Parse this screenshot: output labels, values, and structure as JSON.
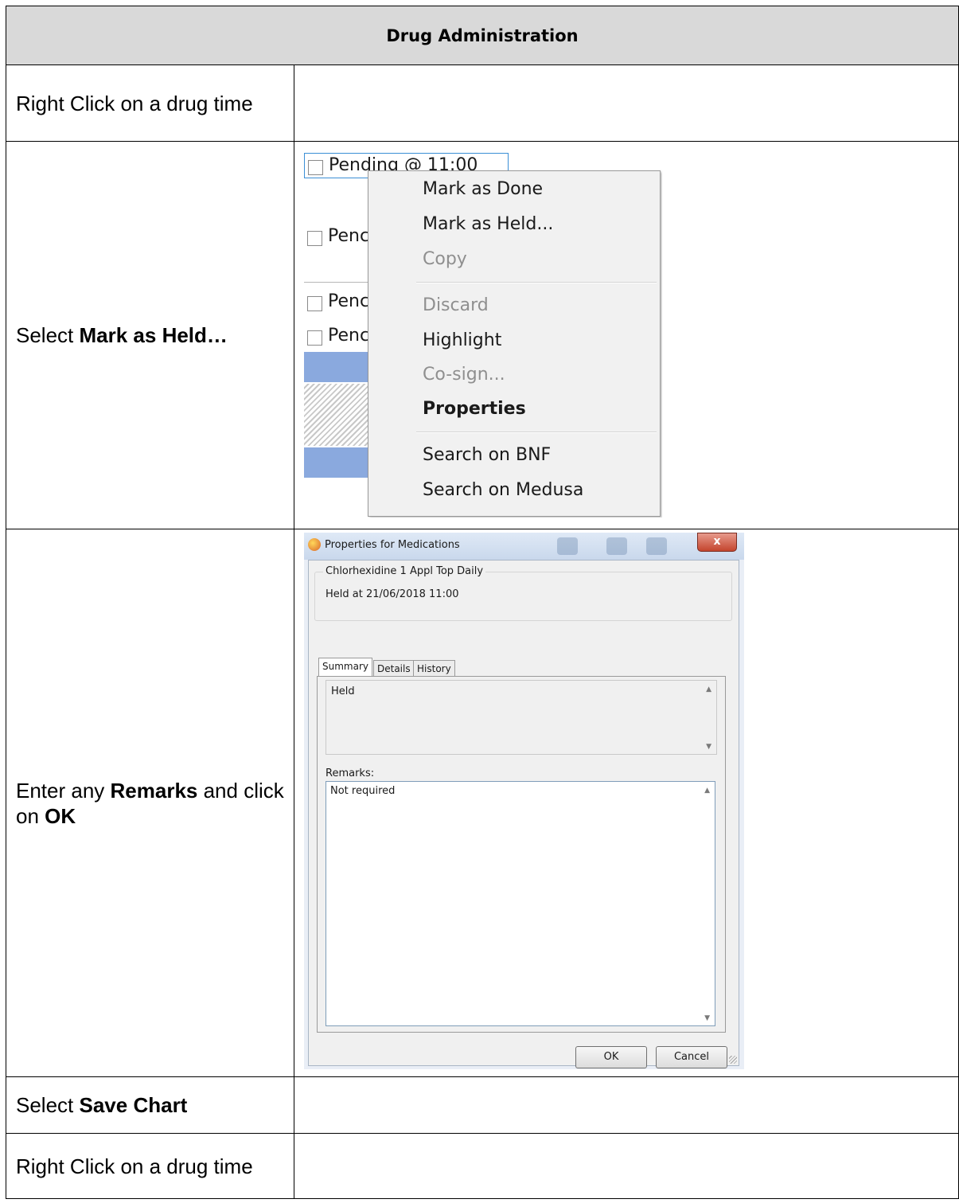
{
  "table": {
    "header": "Drug Administration",
    "steps": {
      "s1": "Right Click on a drug time",
      "s2_pre": "Select ",
      "s2_bold": "Mark as Held…",
      "s3_pre": "Enter any ",
      "s3_bold1": "Remarks",
      "s3_mid": " and click on ",
      "s3_bold2": "OK",
      "s4_pre": "Select ",
      "s4_bold": "Save Chart",
      "s5": "Right Click on a drug time"
    }
  },
  "list": {
    "first_row": "Pending @ 11:00",
    "partial": "Penc"
  },
  "context_menu": {
    "items": [
      "Mark as Done",
      "Mark as Held...",
      "Copy",
      "Discard",
      "Highlight",
      "Co-sign...",
      "Properties",
      "Search on BNF",
      "Search on Medusa"
    ]
  },
  "dialog": {
    "title": "Properties for Medications",
    "close_label": "x",
    "group_title": "Chlorhexidine 1 Appl Top Daily",
    "held_at": "Held at 21/06/2018 11:00",
    "tabs": [
      "Summary",
      "Details",
      "History"
    ],
    "summary_text": "Held",
    "remarks_label": "Remarks:",
    "remarks_value": "Not required",
    "ok_label": "OK",
    "cancel_label": "Cancel"
  }
}
